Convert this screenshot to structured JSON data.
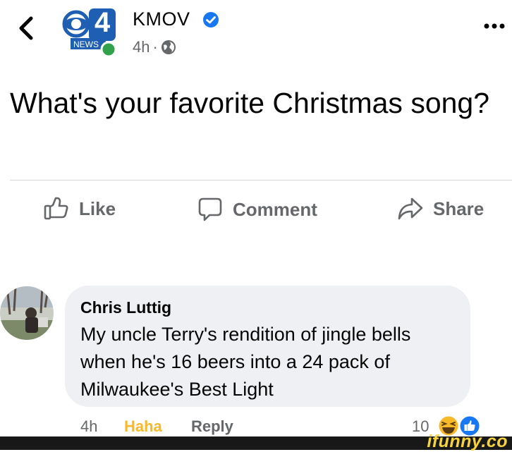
{
  "header": {
    "page_name": "KMOV",
    "logo_number": "4",
    "logo_text": "NEWS",
    "time": "4h",
    "separator": "·",
    "back_icon": "chevron-left-icon",
    "privacy_icon": "globe-icon",
    "more_icon": "ellipsis-icon"
  },
  "post": {
    "text": "What's your favorite Christmas song?"
  },
  "actions": {
    "like_label": "Like",
    "comment_label": "Comment",
    "share_label": "Share"
  },
  "comment": {
    "author": "Chris Luttig",
    "text": "My uncle Terry's rendition of jingle bells when he's 16 beers into a 24 pack of Milwaukee's Best Light",
    "time": "4h",
    "reaction_label": "Haha",
    "reply_label": "Reply",
    "reaction_count": "10"
  },
  "watermark": {
    "text": "ifunny.co"
  },
  "colors": {
    "verified_blue": "#1877f2",
    "online_green": "#31a24c",
    "haha_yellow": "#f7b928",
    "secondary_text": "#65676b",
    "bubble_bg": "#eef0f3"
  }
}
